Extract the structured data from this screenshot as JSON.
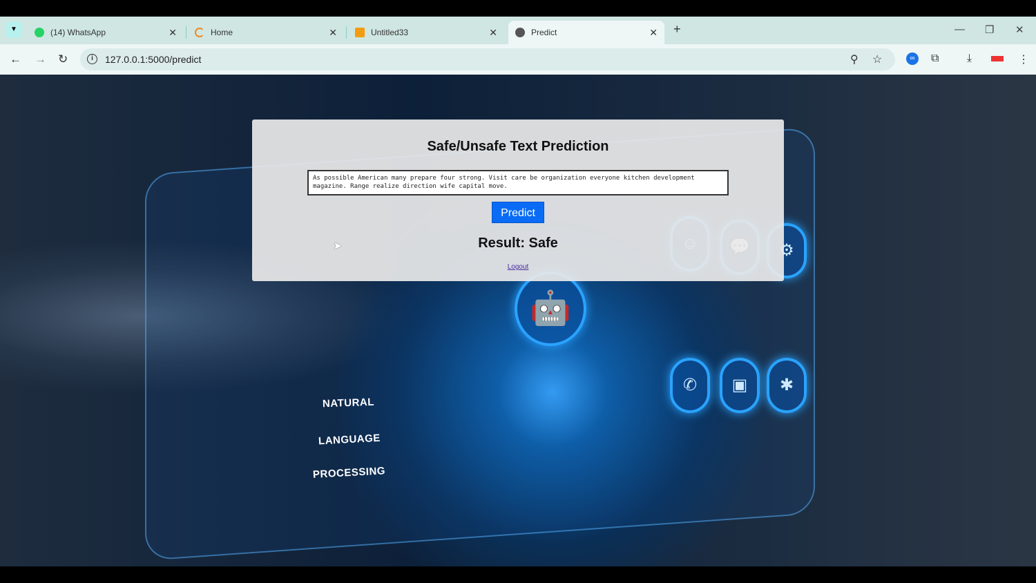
{
  "browser": {
    "tabs": [
      {
        "label": "(14) WhatsApp",
        "icon": "whatsapp-icon",
        "color": "#25d366"
      },
      {
        "label": "Home",
        "icon": "loading-icon",
        "color": "#f08a24"
      },
      {
        "label": "Untitled33",
        "icon": "notebook-icon",
        "color": "#f39c12"
      },
      {
        "label": "Predict",
        "icon": "globe-icon",
        "color": "#555555"
      }
    ],
    "url": "127.0.0.1:5000/predict"
  },
  "background": {
    "words": [
      "NATURAL",
      "LANGUAGE",
      "PROCESSING"
    ]
  },
  "card": {
    "title": "Safe/Unsafe Text Prediction",
    "input_text": "As possible American many prepare four strong. Visit care be organization everyone kitchen development magazine. Range realize direction wife capital move.",
    "predict_label": "Predict",
    "result": "Result: Safe",
    "logout": "Logout"
  }
}
